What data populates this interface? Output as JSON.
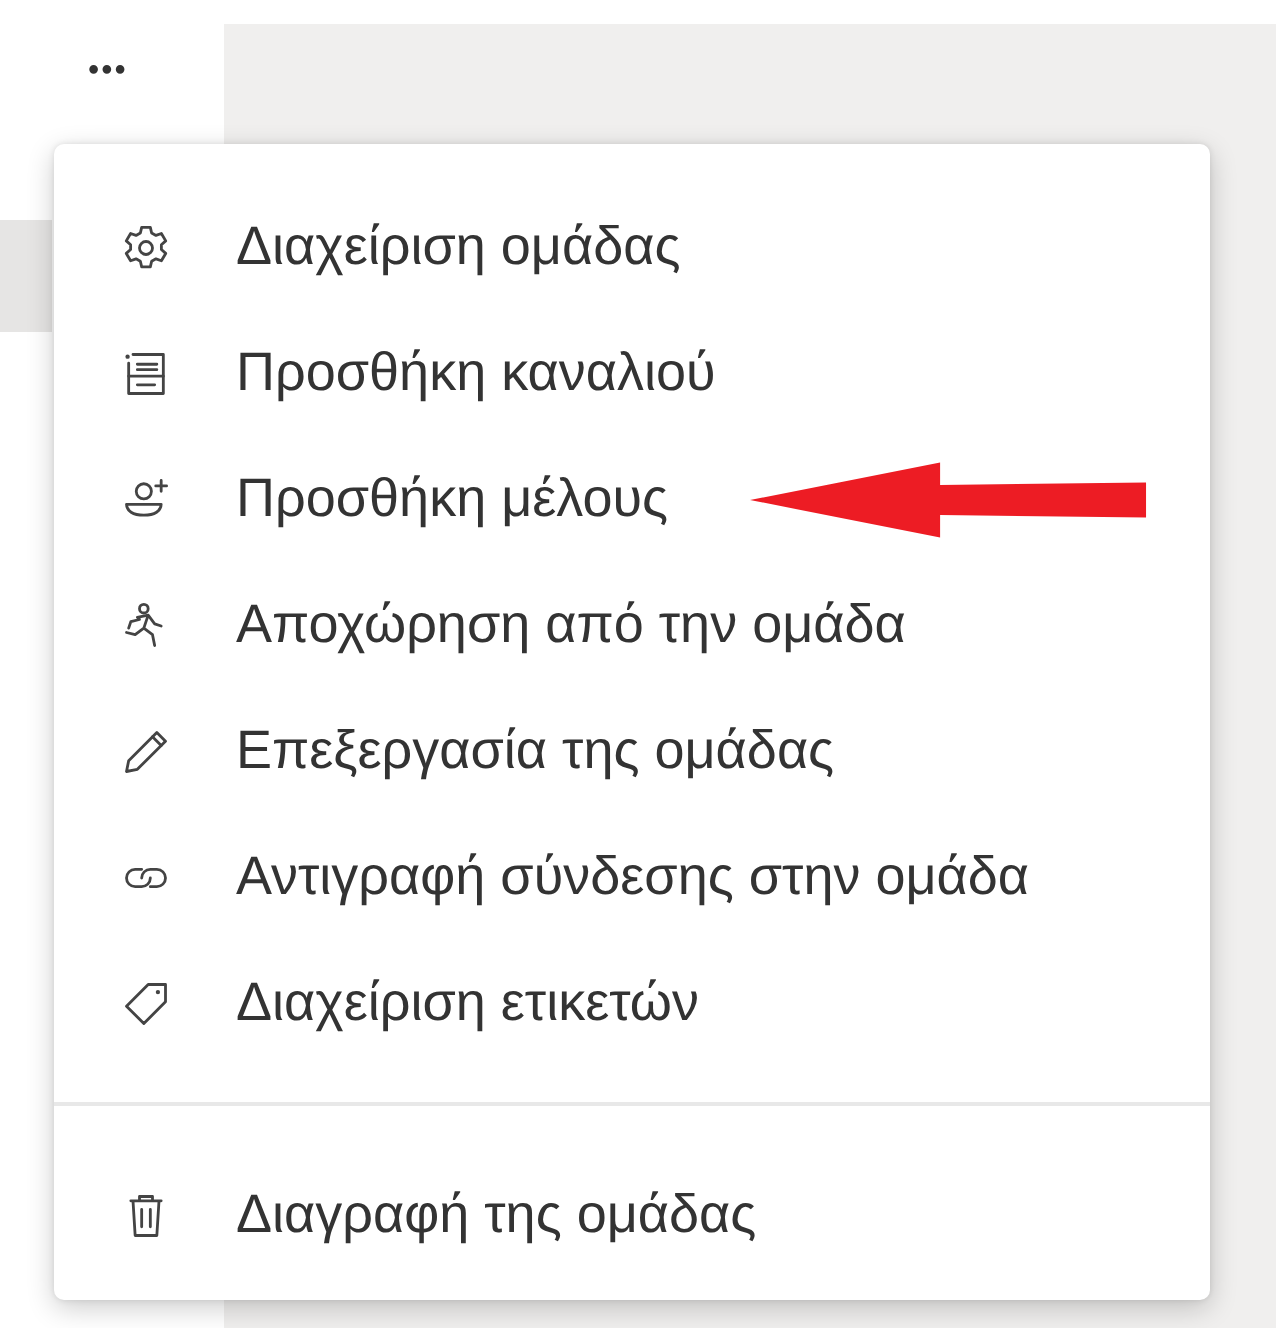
{
  "more_button": {
    "label": "•••"
  },
  "menu": {
    "sections": [
      {
        "items": [
          {
            "kind": "gear",
            "label": "Διαχείριση ομάδας",
            "pointed": false
          },
          {
            "kind": "channel",
            "label": "Προσθήκη καναλιού",
            "pointed": false
          },
          {
            "kind": "add-person",
            "label": "Προσθήκη μέλους",
            "pointed": true
          },
          {
            "kind": "leave",
            "label": "Αποχώρηση από την ομάδα",
            "pointed": false
          },
          {
            "kind": "pencil",
            "label": "Επεξεργασία της ομάδας",
            "pointed": false
          },
          {
            "kind": "link",
            "label": "Αντιγραφή σύνδεσης στην ομάδα",
            "pointed": false
          },
          {
            "kind": "tag",
            "label": "Διαχείριση ετικετών",
            "pointed": false
          }
        ]
      },
      {
        "items": [
          {
            "kind": "trash",
            "label": "Διαγραφή της ομάδας",
            "pointed": false
          }
        ]
      }
    ]
  },
  "annotation": {
    "color": "#ed1c24"
  }
}
